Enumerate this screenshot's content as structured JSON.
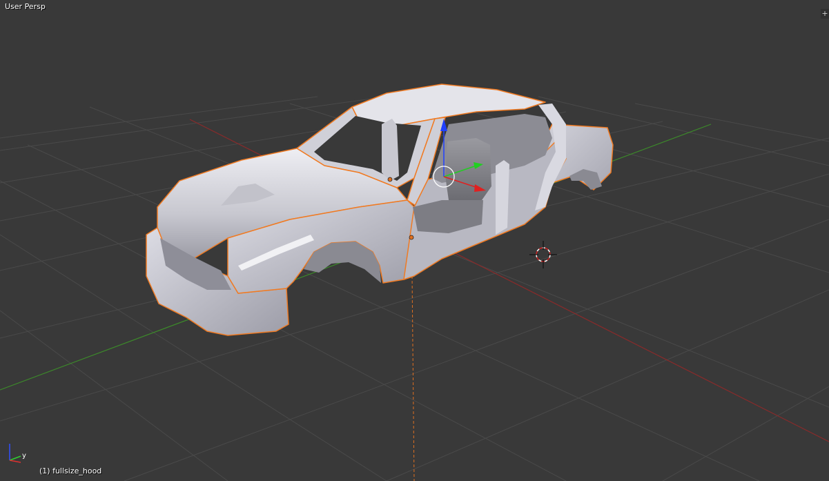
{
  "viewport": {
    "view_name": "User Persp",
    "object_info": "(1) fullsize_hood",
    "expand_handle": "+"
  },
  "colors": {
    "background": "#393939",
    "grid": "#4a4a4a",
    "x_axis": "#8a2a2a",
    "y_axis": "#3c8a2a",
    "selection_outline": "#f07a22",
    "gizmo_x": "#e02020",
    "gizmo_y": "#20d020",
    "gizmo_z": "#2040ff"
  },
  "axis_widget": {
    "y_label": "y"
  }
}
